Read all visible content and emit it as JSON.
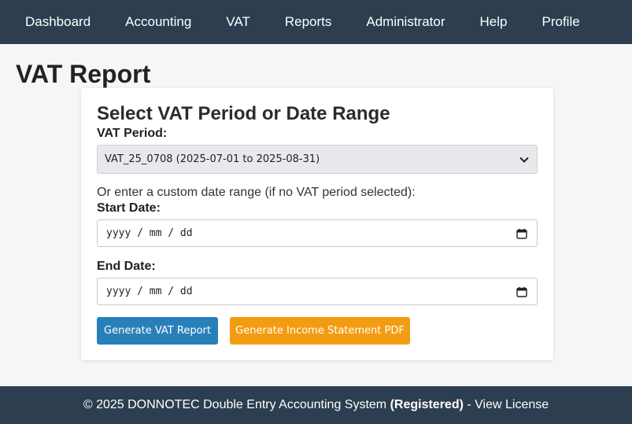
{
  "nav": {
    "items": [
      "Dashboard",
      "Accounting",
      "VAT",
      "Reports",
      "Administrator",
      "Help",
      "Profile"
    ]
  },
  "page": {
    "title": "VAT Report"
  },
  "form": {
    "title": "Select VAT Period or Date Range",
    "vat_period_label": "VAT Period:",
    "vat_period_value": "VAT_25_0708 (2025-07-01 to 2025-08-31)",
    "custom_range_hint": "Or enter a custom date range (if no VAT period selected):",
    "start_date_label": "Start Date:",
    "start_date_placeholder": "yyyy / mm / dd",
    "end_date_label": "End Date:",
    "end_date_placeholder": "yyyy / mm / dd",
    "generate_vat_label": "Generate VAT Report",
    "generate_income_label": "Generate Income Statement PDF"
  },
  "footer": {
    "copyright": "© 2025 DONNOTEC Double Entry Accounting System",
    "status": "(Registered)",
    "separator": "-",
    "license_link": "View License"
  },
  "colors": {
    "navbar": "#2c3e50",
    "primary_button": "#2980b9",
    "secondary_button": "#f39c12",
    "page_background": "#f4f6f8"
  },
  "icons": {
    "select": "chevron-down-icon",
    "date": "calendar-icon"
  }
}
